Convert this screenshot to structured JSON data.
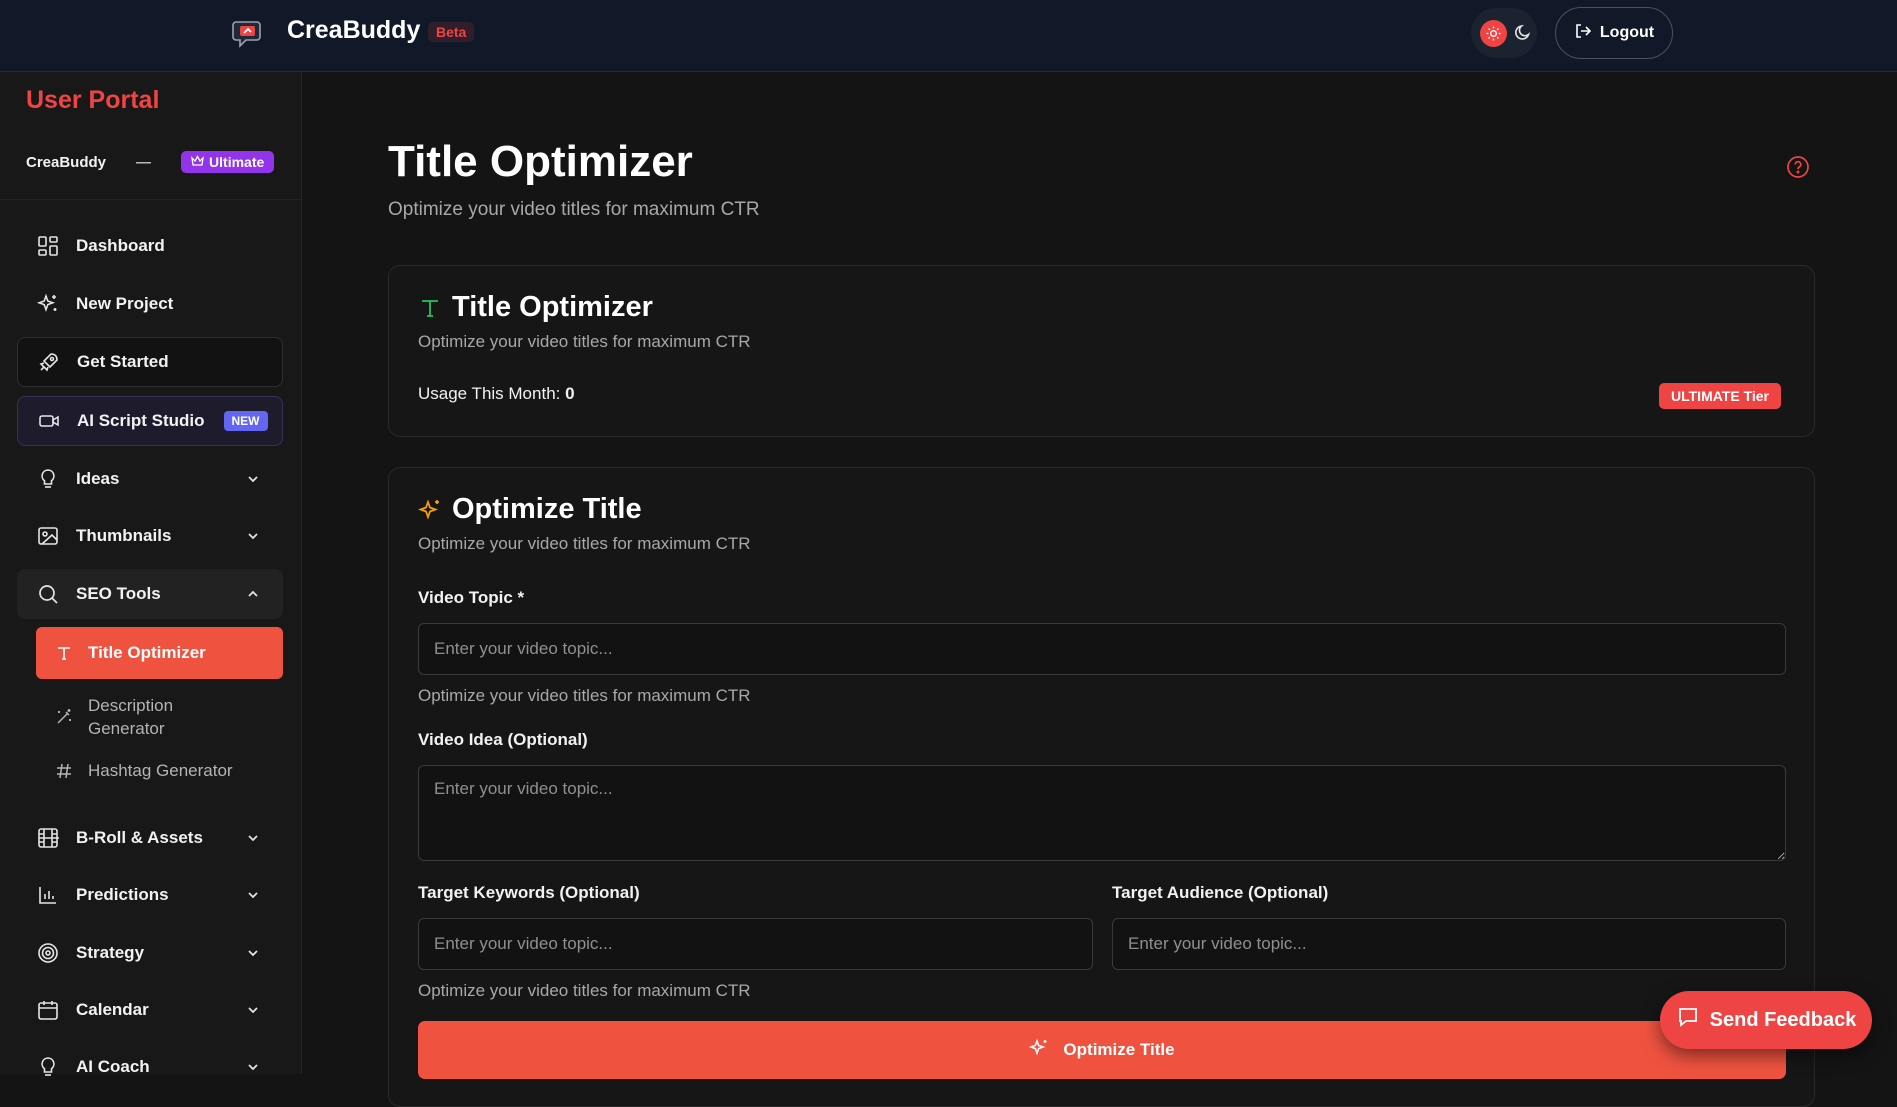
{
  "header": {
    "brand": "CreaBuddy",
    "beta_label": "Beta",
    "logout_label": "Logout",
    "accent_color": "#ef4444"
  },
  "sidebar": {
    "portal_title": "User Portal",
    "user_name": "CreaBuddy",
    "user_separator": "—",
    "tier_label": "Ultimate",
    "items": [
      {
        "label": "Dashboard",
        "icon": "dashboard-icon"
      },
      {
        "label": "New Project",
        "icon": "sparkles-icon"
      },
      {
        "label": "Get Started",
        "icon": "rocket-icon"
      },
      {
        "label": "AI Script Studio",
        "icon": "video-icon",
        "badge": "NEW"
      },
      {
        "label": "Ideas",
        "icon": "lightbulb-icon"
      },
      {
        "label": "Thumbnails",
        "icon": "image-icon"
      },
      {
        "label": "SEO Tools",
        "icon": "search-icon"
      },
      {
        "label": "B-Roll & Assets",
        "icon": "film-icon"
      },
      {
        "label": "Predictions",
        "icon": "bar-chart-icon"
      },
      {
        "label": "Strategy",
        "icon": "target-icon"
      },
      {
        "label": "Calendar",
        "icon": "calendar-icon"
      },
      {
        "label": "AI Coach",
        "icon": "lightbulb-icon"
      }
    ],
    "seo_sub": [
      {
        "label": "Title Optimizer",
        "icon": "type-icon",
        "active": true
      },
      {
        "label": "Description Generator",
        "icon": "magic-wand-icon"
      },
      {
        "label": "Hashtag Generator",
        "icon": "hash-icon"
      }
    ]
  },
  "page": {
    "title": "Title Optimizer",
    "subtitle": "Optimize your video titles for maximum CTR"
  },
  "info_card": {
    "title": "Title Optimizer",
    "subtitle": "Optimize your video titles for maximum CTR",
    "usage_label": "Usage This Month:",
    "usage_value": "0",
    "tier_badge": "ULTIMATE Tier"
  },
  "form_card": {
    "title": "Optimize Title",
    "subtitle": "Optimize your video titles for maximum CTR",
    "video_topic_label": "Video Topic *",
    "video_topic_placeholder": "Enter your video topic...",
    "video_topic_hint": "Optimize your video titles for maximum CTR",
    "video_idea_label": "Video Idea (Optional)",
    "video_idea_placeholder": "Enter your video topic...",
    "keywords_label": "Target Keywords (Optional)",
    "keywords_placeholder": "Enter your video topic...",
    "audience_label": "Target Audience (Optional)",
    "audience_placeholder": "Enter your video topic...",
    "bottom_hint": "Optimize your video titles for maximum CTR",
    "submit_label": "Optimize Title"
  },
  "feedback_label": "Send Feedback"
}
